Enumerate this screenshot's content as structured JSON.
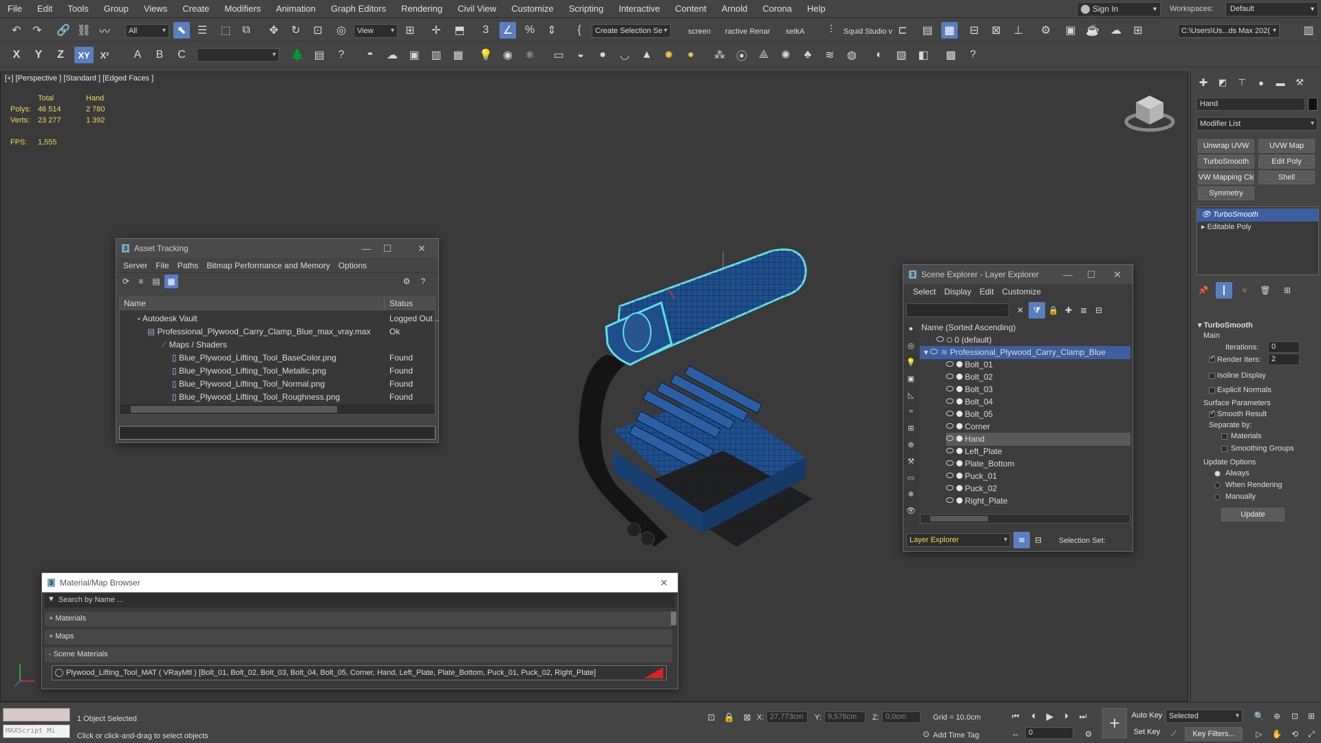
{
  "menu": [
    "File",
    "Edit",
    "Tools",
    "Group",
    "Views",
    "Create",
    "Modifiers",
    "Animation",
    "Graph Editors",
    "Rendering",
    "Civil View",
    "Customize",
    "Scripting",
    "Interactive",
    "Content",
    "Arnold",
    "Corona",
    "Help"
  ],
  "signin": "Sign In",
  "workspaces_label": "Workspaces:",
  "workspace": "Default",
  "toolbar": {
    "filter": "All",
    "view": "View",
    "selset": "Create Selection Se",
    "screen": "screen",
    "interactive": "ractive Renar",
    "setka": "setkA",
    "squid": "Squid Studio v",
    "path": "C:\\Users\\Us...ds Max 202("
  },
  "axis": {
    "x": "X",
    "y": "Y",
    "z": "Z",
    "xy": "XY",
    "xy2": "X²"
  },
  "viewport": {
    "label": "[+] [Perspective ] [Standard ] [Edged Faces ]",
    "total": "Total",
    "hand": "Hand",
    "polys_label": "Polys:",
    "polys_total": "46 514",
    "polys_hand": "2 780",
    "verts_label": "Verts:",
    "verts_total": "23 277",
    "verts_hand": "1 392",
    "fps_label": "FPS:",
    "fps": "1,555"
  },
  "asset": {
    "title": "Asset Tracking",
    "menu": [
      "Server",
      "File",
      "Paths",
      "Bitmap Performance and Memory",
      "Options"
    ],
    "col_name": "Name",
    "col_status": "Status",
    "rows": [
      {
        "name": "Autodesk Vault",
        "status": "Logged Out .."
      },
      {
        "name": "Professional_Plywood_Carry_Clamp_Blue_max_vray.max",
        "status": "Ok"
      },
      {
        "name": "Maps / Shaders",
        "status": ""
      },
      {
        "name": "Blue_Plywood_Lifting_Tool_BaseColor.png",
        "status": "Found"
      },
      {
        "name": "Blue_Plywood_Lifting_Tool_Metallic.png",
        "status": "Found"
      },
      {
        "name": "Blue_Plywood_Lifting_Tool_Normal.png",
        "status": "Found"
      },
      {
        "name": "Blue_Plywood_Lifting_Tool_Roughness.png",
        "status": "Found"
      }
    ]
  },
  "scene": {
    "title": "Scene Explorer - Layer Explorer",
    "menu": [
      "Select",
      "Display",
      "Edit",
      "Customize"
    ],
    "col": "Name (Sorted Ascending)",
    "default_layer": "0 (default)",
    "group": "Professional_Plywood_Carry_Clamp_Blue",
    "items": [
      "Bolt_01",
      "Bolt_02",
      "Bolt_03",
      "Bolt_04",
      "Bolt_05",
      "Corner",
      "Hand",
      "Left_Plate",
      "Plate_Bottom",
      "Puck_01",
      "Puck_02",
      "Right_Plate"
    ],
    "footer": "Layer Explorer",
    "selset": "Selection Set:"
  },
  "matbrowser": {
    "title": "Material/Map Browser",
    "search": "Search by Name ...",
    "materials": "+ Materials",
    "maps": "+ Maps",
    "scene_materials": "- Scene Materials",
    "material": "Plywood_Lifting_Tool_MAT  ( VRayMtl )  [Bolt_01, Bolt_02, Bolt_03, Bolt_04, Bolt_05, Corner, Hand, Left_Plate, Plate_Bottom, Puck_01, Puck_02, Right_Plate]"
  },
  "panel": {
    "object": "Hand",
    "modlist": "Modifier List",
    "buttons": [
      "Unwrap UVW",
      "UVW Map",
      "TurboSmooth",
      "Edit Poly",
      "VW Mapping Clea",
      "Shell",
      "Symmetry"
    ],
    "stack": [
      "TurboSmooth",
      "Editable Poly"
    ],
    "ts_title": "TurboSmooth",
    "main": "Main",
    "iterations": "Iterations:",
    "iterations_val": "0",
    "render_iters": "Render Iters:",
    "render_iters_val": "2",
    "isoline": "Isoline Display",
    "explicit": "Explicit Normals",
    "surface": "Surface Parameters",
    "smooth": "Smooth Result",
    "separate": "Separate by:",
    "materials": "Materials",
    "smoothing": "Smoothing Groups",
    "update_opts": "Update Options",
    "always": "Always",
    "when": "When Rendering",
    "manually": "Manually",
    "update": "Update"
  },
  "status": {
    "maxscript": "MAXScript Mi",
    "selected": "1 Object Selected",
    "hint": "Click or click-and-drag to select objects",
    "x_label": "X:",
    "x": "27,773cm",
    "y_label": "Y:",
    "y": "9,578cm",
    "z_label": "Z:",
    "z": "0,0cm",
    "grid": "Grid = 10,0cm",
    "add_time_tag": "Add Time Tag",
    "autokey": "Auto Key",
    "setkey": "Set Key",
    "selected_dd": "Selected",
    "frame": "0",
    "key_filters": "Key Filters..."
  },
  "colors": {
    "accent": "#5a7fc0",
    "model_blue": "#1f4e8c",
    "selection_cyan": "#5fe0e8",
    "highlight_row": "#3d5fa0"
  }
}
